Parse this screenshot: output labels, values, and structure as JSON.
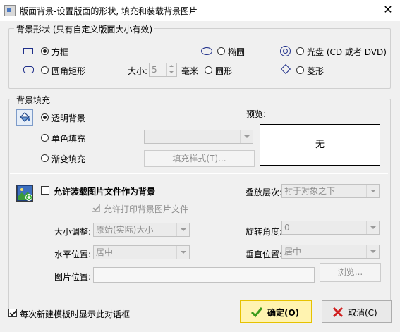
{
  "window": {
    "title": "版面背景-设置版面的形状, 填充和装载背景图片",
    "close_glyph": "✕"
  },
  "shape_group": {
    "legend": "背景形状 (只有自定义版面大小有效)",
    "options": {
      "square": "方框",
      "rounded": "圆角矩形",
      "ellipse": "椭圆",
      "circle": "圆形",
      "disc": "光盘 (CD 或者 DVD)",
      "diamond": "菱形"
    },
    "selected": "square",
    "size_label": "大小:",
    "size_value": "5",
    "size_unit": "毫米"
  },
  "fill_group": {
    "legend": "背景填充",
    "options": {
      "transparent": "透明背景",
      "solid": "单色填充",
      "gradient": "渐变填充"
    },
    "selected": "transparent",
    "fill_style_button": "填充样式(T)...",
    "preview_label": "预览:",
    "preview_text": "无"
  },
  "image_section": {
    "load_image_label": "允许装载图片文件作为背景",
    "allow_print_label": "允许打印背景图片文件",
    "stack_label": "叠放层次:",
    "stack_value": "衬于对象之下",
    "size_adjust_label": "大小调整:",
    "size_adjust_value": "原始(实际)大小",
    "rotation_label": "旋转角度:",
    "rotation_value": "0",
    "h_pos_label": "水平位置:",
    "h_pos_value": "居中",
    "v_pos_label": "垂直位置:",
    "v_pos_value": "居中",
    "image_path_label": "图片位置:",
    "image_path_value": "",
    "browse_button": "浏览..."
  },
  "footer": {
    "show_dialog_label": "每次新建模板时显示此对话框",
    "ok_button": "确定(O)",
    "cancel_button": "取消(C)"
  },
  "colors": {
    "accent_border": "#e6c200",
    "ok_fill": "#fff3b0",
    "dialog_bg": "#f0f0f0"
  }
}
